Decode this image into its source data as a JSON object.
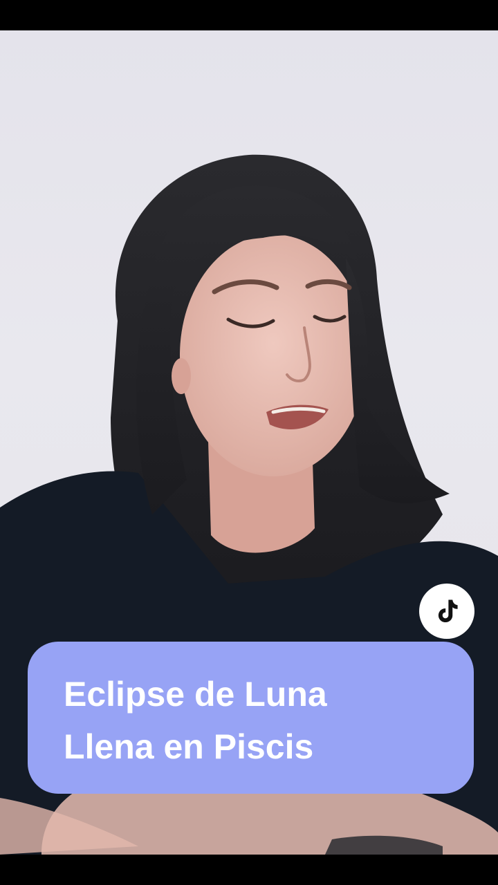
{
  "colors": {
    "caption_background": "#97a3f5",
    "caption_text": "#ffffff",
    "badge_background": "#ffffff",
    "badge_icon": "#111111",
    "letterbox": "#000000"
  },
  "caption": {
    "lines": [
      "Eclipse de Luna",
      "Llena en Piscis"
    ]
  },
  "badge": {
    "icon": "tiktok-logo-icon"
  },
  "scene": {
    "subject": "woman-with-dark-hair-in-black-top"
  }
}
